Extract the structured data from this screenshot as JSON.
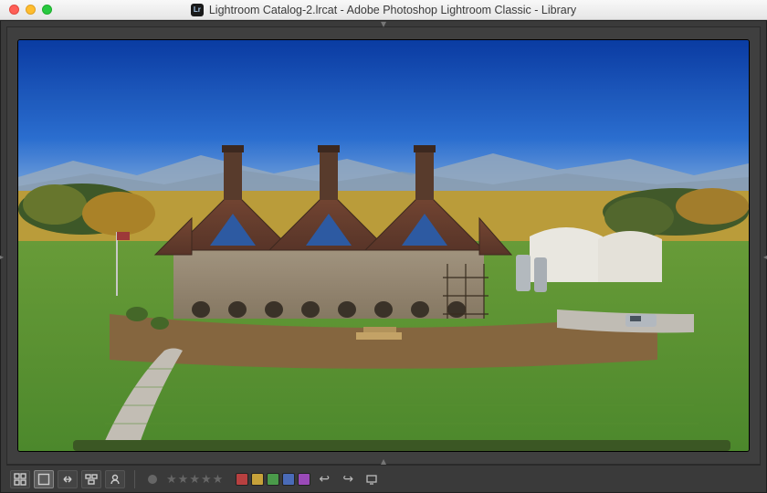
{
  "window": {
    "title": "Lightroom Catalog-2.lrcat - Adobe Photoshop Lightroom Classic - Library",
    "app_short": "Lr"
  },
  "toolbar": {
    "view_modes": {
      "grid": "Grid View",
      "loupe": "Loupe View",
      "compare": "Compare View",
      "survey": "Survey View",
      "people": "People View"
    },
    "rating_stars": 5,
    "color_labels": [
      "#b84040",
      "#c7a23a",
      "#4a9a4a",
      "#4a6bb8",
      "#9a4ab8"
    ],
    "nav": {
      "prev": "Previous Photo",
      "next": "Next Photo",
      "slideshow": "Impromptu Slideshow"
    }
  },
  "panel_arrows": {
    "top": "Show Module Picker",
    "bottom": "Show Filmstrip",
    "left": "Show Left Panels",
    "right": "Show Right Panels"
  }
}
